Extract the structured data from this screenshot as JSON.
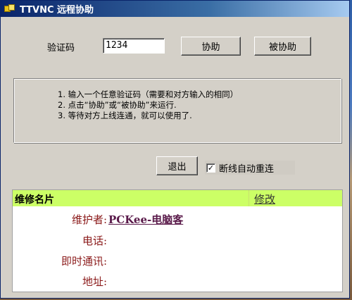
{
  "window": {
    "title": "TTVNC 远程协助"
  },
  "verification": {
    "label": "验证码",
    "value": "1234",
    "assist_label": "协助",
    "be_assisted_label": "被协助"
  },
  "instructions": [
    "1. 输入一个任意验证码（需要和对方输入的相同）",
    "2. 点击“协助”或“被协助”来运行.",
    "3. 等待对方上线连通，就可以使用了."
  ],
  "controls": {
    "exit_label": "退出",
    "auto_reconnect_label": "断线自动重连",
    "auto_reconnect_checked": "✓"
  },
  "card": {
    "title": "维修名片",
    "edit_label": "修改",
    "maintainer_label": "维护者:",
    "maintainer_value": "PCKee-电脑客",
    "phone_label": "电话:",
    "im_label": "即时通讯:",
    "address_label": "地址:"
  },
  "colors": {
    "card_header": "#ccff66",
    "titlebar_start": "#0a246a",
    "label_red": "#8b1a1a"
  }
}
